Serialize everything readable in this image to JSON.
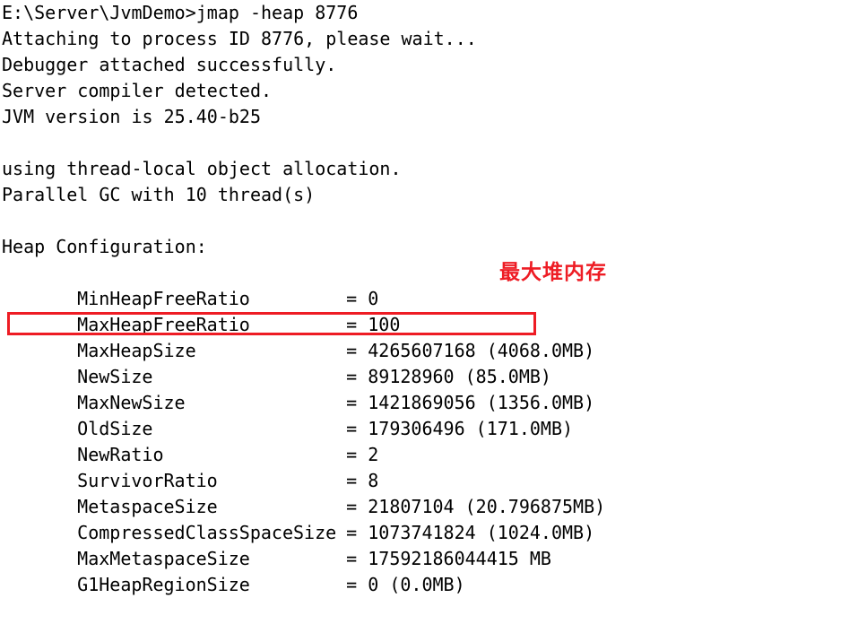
{
  "terminal": {
    "background_color": "#ffffff",
    "text_color": "#000000",
    "prompt_line": "E:\\Server\\JvmDemo>jmap -heap 8776",
    "output_lines": [
      "Attaching to process ID 8776, please wait...",
      "Debugger attached successfully.",
      "Server compiler detected.",
      "JVM version is 25.40-b25"
    ],
    "gc_lines": [
      "using thread-local object allocation.",
      "Parallel GC with 10 thread(s)"
    ],
    "section_title": "Heap Configuration:",
    "config_rows": [
      {
        "name": "MinHeapFreeRatio",
        "eq": "=",
        "value": "0"
      },
      {
        "name": "MaxHeapFreeRatio",
        "eq": "=",
        "value": "100"
      },
      {
        "name": "MaxHeapSize",
        "eq": "=",
        "value": "4265607168 (4068.0MB)"
      },
      {
        "name": "NewSize",
        "eq": "=",
        "value": "89128960 (85.0MB)"
      },
      {
        "name": "MaxNewSize",
        "eq": "=",
        "value": "1421869056 (1356.0MB)"
      },
      {
        "name": "OldSize",
        "eq": "=",
        "value": "179306496 (171.0MB)"
      },
      {
        "name": "NewRatio",
        "eq": "=",
        "value": "2"
      },
      {
        "name": "SurvivorRatio",
        "eq": "=",
        "value": "8"
      },
      {
        "name": "MetaspaceSize",
        "eq": "=",
        "value": "21807104 (20.796875MB)"
      },
      {
        "name": "CompressedClassSpaceSize",
        "eq": "=",
        "value": "1073741824 (1024.0MB)"
      },
      {
        "name": "MaxMetaspaceSize",
        "eq": "=",
        "value": "17592186044415 MB"
      },
      {
        "name": "G1HeapRegionSize",
        "eq": "=",
        "value": "0 (0.0MB)"
      }
    ]
  },
  "annotations": {
    "color": "#ee1c24",
    "max_heap_label": "最大堆内存",
    "highlight_target": "MaxHeapSize"
  }
}
